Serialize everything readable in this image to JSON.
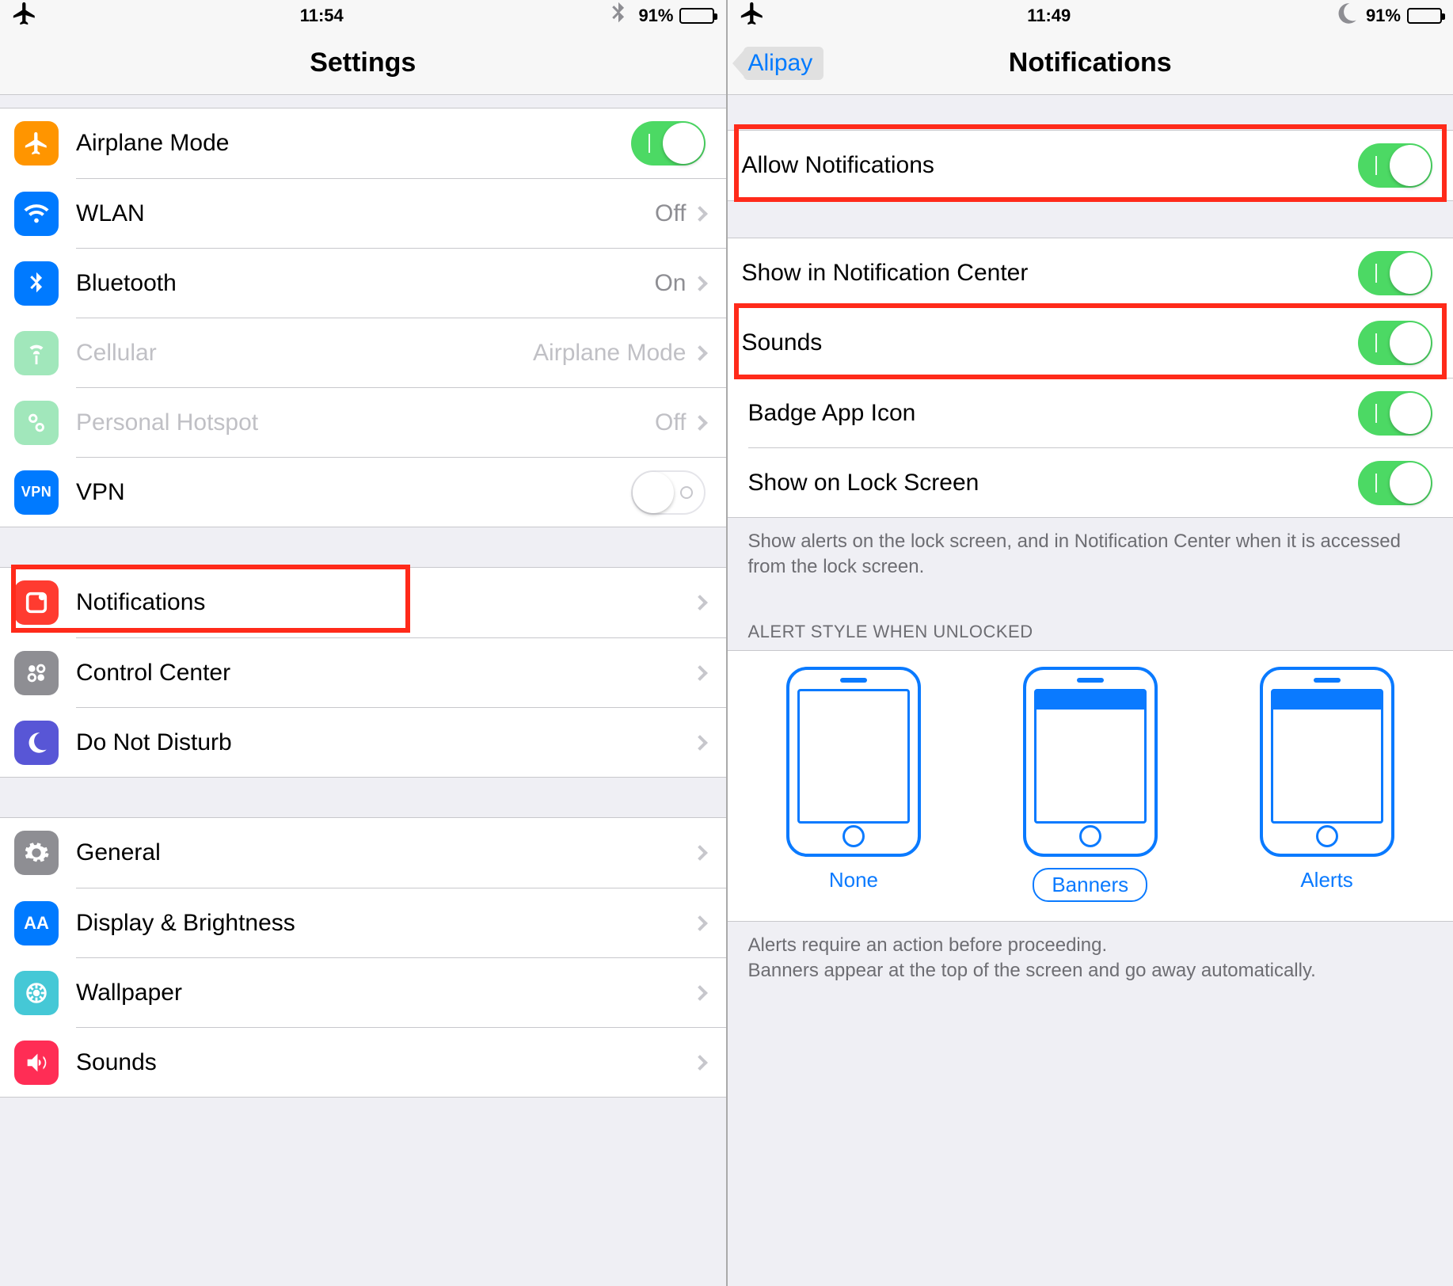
{
  "left": {
    "status": {
      "time": "11:54",
      "battery_pct": "91%",
      "airplane": true,
      "bt": true
    },
    "title": "Settings",
    "rows": {
      "airplane": {
        "label": "Airplane Mode",
        "toggleOn": true
      },
      "wlan": {
        "label": "WLAN",
        "value": "Off"
      },
      "bluetooth": {
        "label": "Bluetooth",
        "value": "On"
      },
      "cellular": {
        "label": "Cellular",
        "value": "Airplane Mode",
        "disabled": true
      },
      "hotspot": {
        "label": "Personal Hotspot",
        "value": "Off",
        "disabled": true
      },
      "vpn": {
        "label": "VPN",
        "icon_text": "VPN",
        "toggleOn": false
      },
      "notifications": {
        "label": "Notifications"
      },
      "control_center": {
        "label": "Control Center"
      },
      "dnd": {
        "label": "Do Not Disturb"
      },
      "general": {
        "label": "General"
      },
      "display": {
        "label": "Display & Brightness",
        "icon_text": "AA"
      },
      "wallpaper": {
        "label": "Wallpaper"
      },
      "sounds": {
        "label": "Sounds"
      }
    }
  },
  "right": {
    "status": {
      "time": "11:49",
      "battery_pct": "91%",
      "dnd": true
    },
    "back_label": "Alipay",
    "title": "Notifications",
    "rows": {
      "allow": {
        "label": "Allow Notifications",
        "on": true
      },
      "center": {
        "label": "Show in Notification Center",
        "on": true
      },
      "sounds": {
        "label": "Sounds",
        "on": true
      },
      "badge": {
        "label": "Badge App Icon",
        "on": true
      },
      "lock": {
        "label": "Show on Lock Screen",
        "on": true
      }
    },
    "footer1": "Show alerts on the lock screen, and in Notification Center when it is accessed from the lock screen.",
    "alert_header": "ALERT STYLE WHEN UNLOCKED",
    "alert_styles": {
      "none": "None",
      "banners": "Banners",
      "alerts": "Alerts",
      "selected": "banners"
    },
    "footer2": "Alerts require an action before proceeding.\nBanners appear at the top of the screen and go away automatically."
  }
}
